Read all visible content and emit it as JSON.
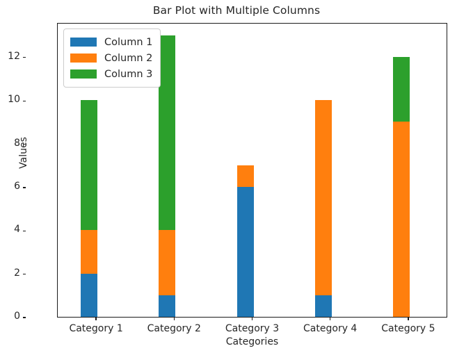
{
  "chart_data": {
    "type": "bar",
    "barmode": "stacked",
    "title": "Bar Plot with Multiple Columns",
    "xlabel": "Categories",
    "ylabel": "Values",
    "categories": [
      "Category 1",
      "Category 2",
      "Category 3",
      "Category 4",
      "Category 5"
    ],
    "series": [
      {
        "name": "Column 1",
        "color": "#1f77b4",
        "values": [
          2,
          1,
          6,
          1,
          0
        ]
      },
      {
        "name": "Column 2",
        "color": "#ff7f0e",
        "values": [
          2,
          3,
          1,
          9,
          9
        ]
      },
      {
        "name": "Column 3",
        "color": "#2ca02c",
        "values": [
          6,
          9,
          0,
          0,
          3
        ]
      }
    ],
    "totals": [
      10,
      13,
      7,
      10,
      12
    ],
    "ylim": [
      0,
      13.6
    ],
    "yticks": [
      0,
      2,
      4,
      6,
      8,
      10,
      12
    ],
    "ytick_labels": [
      "0",
      "2",
      "4",
      "6",
      "8",
      "10",
      "12"
    ],
    "grid": false,
    "legend_position": "upper left"
  }
}
